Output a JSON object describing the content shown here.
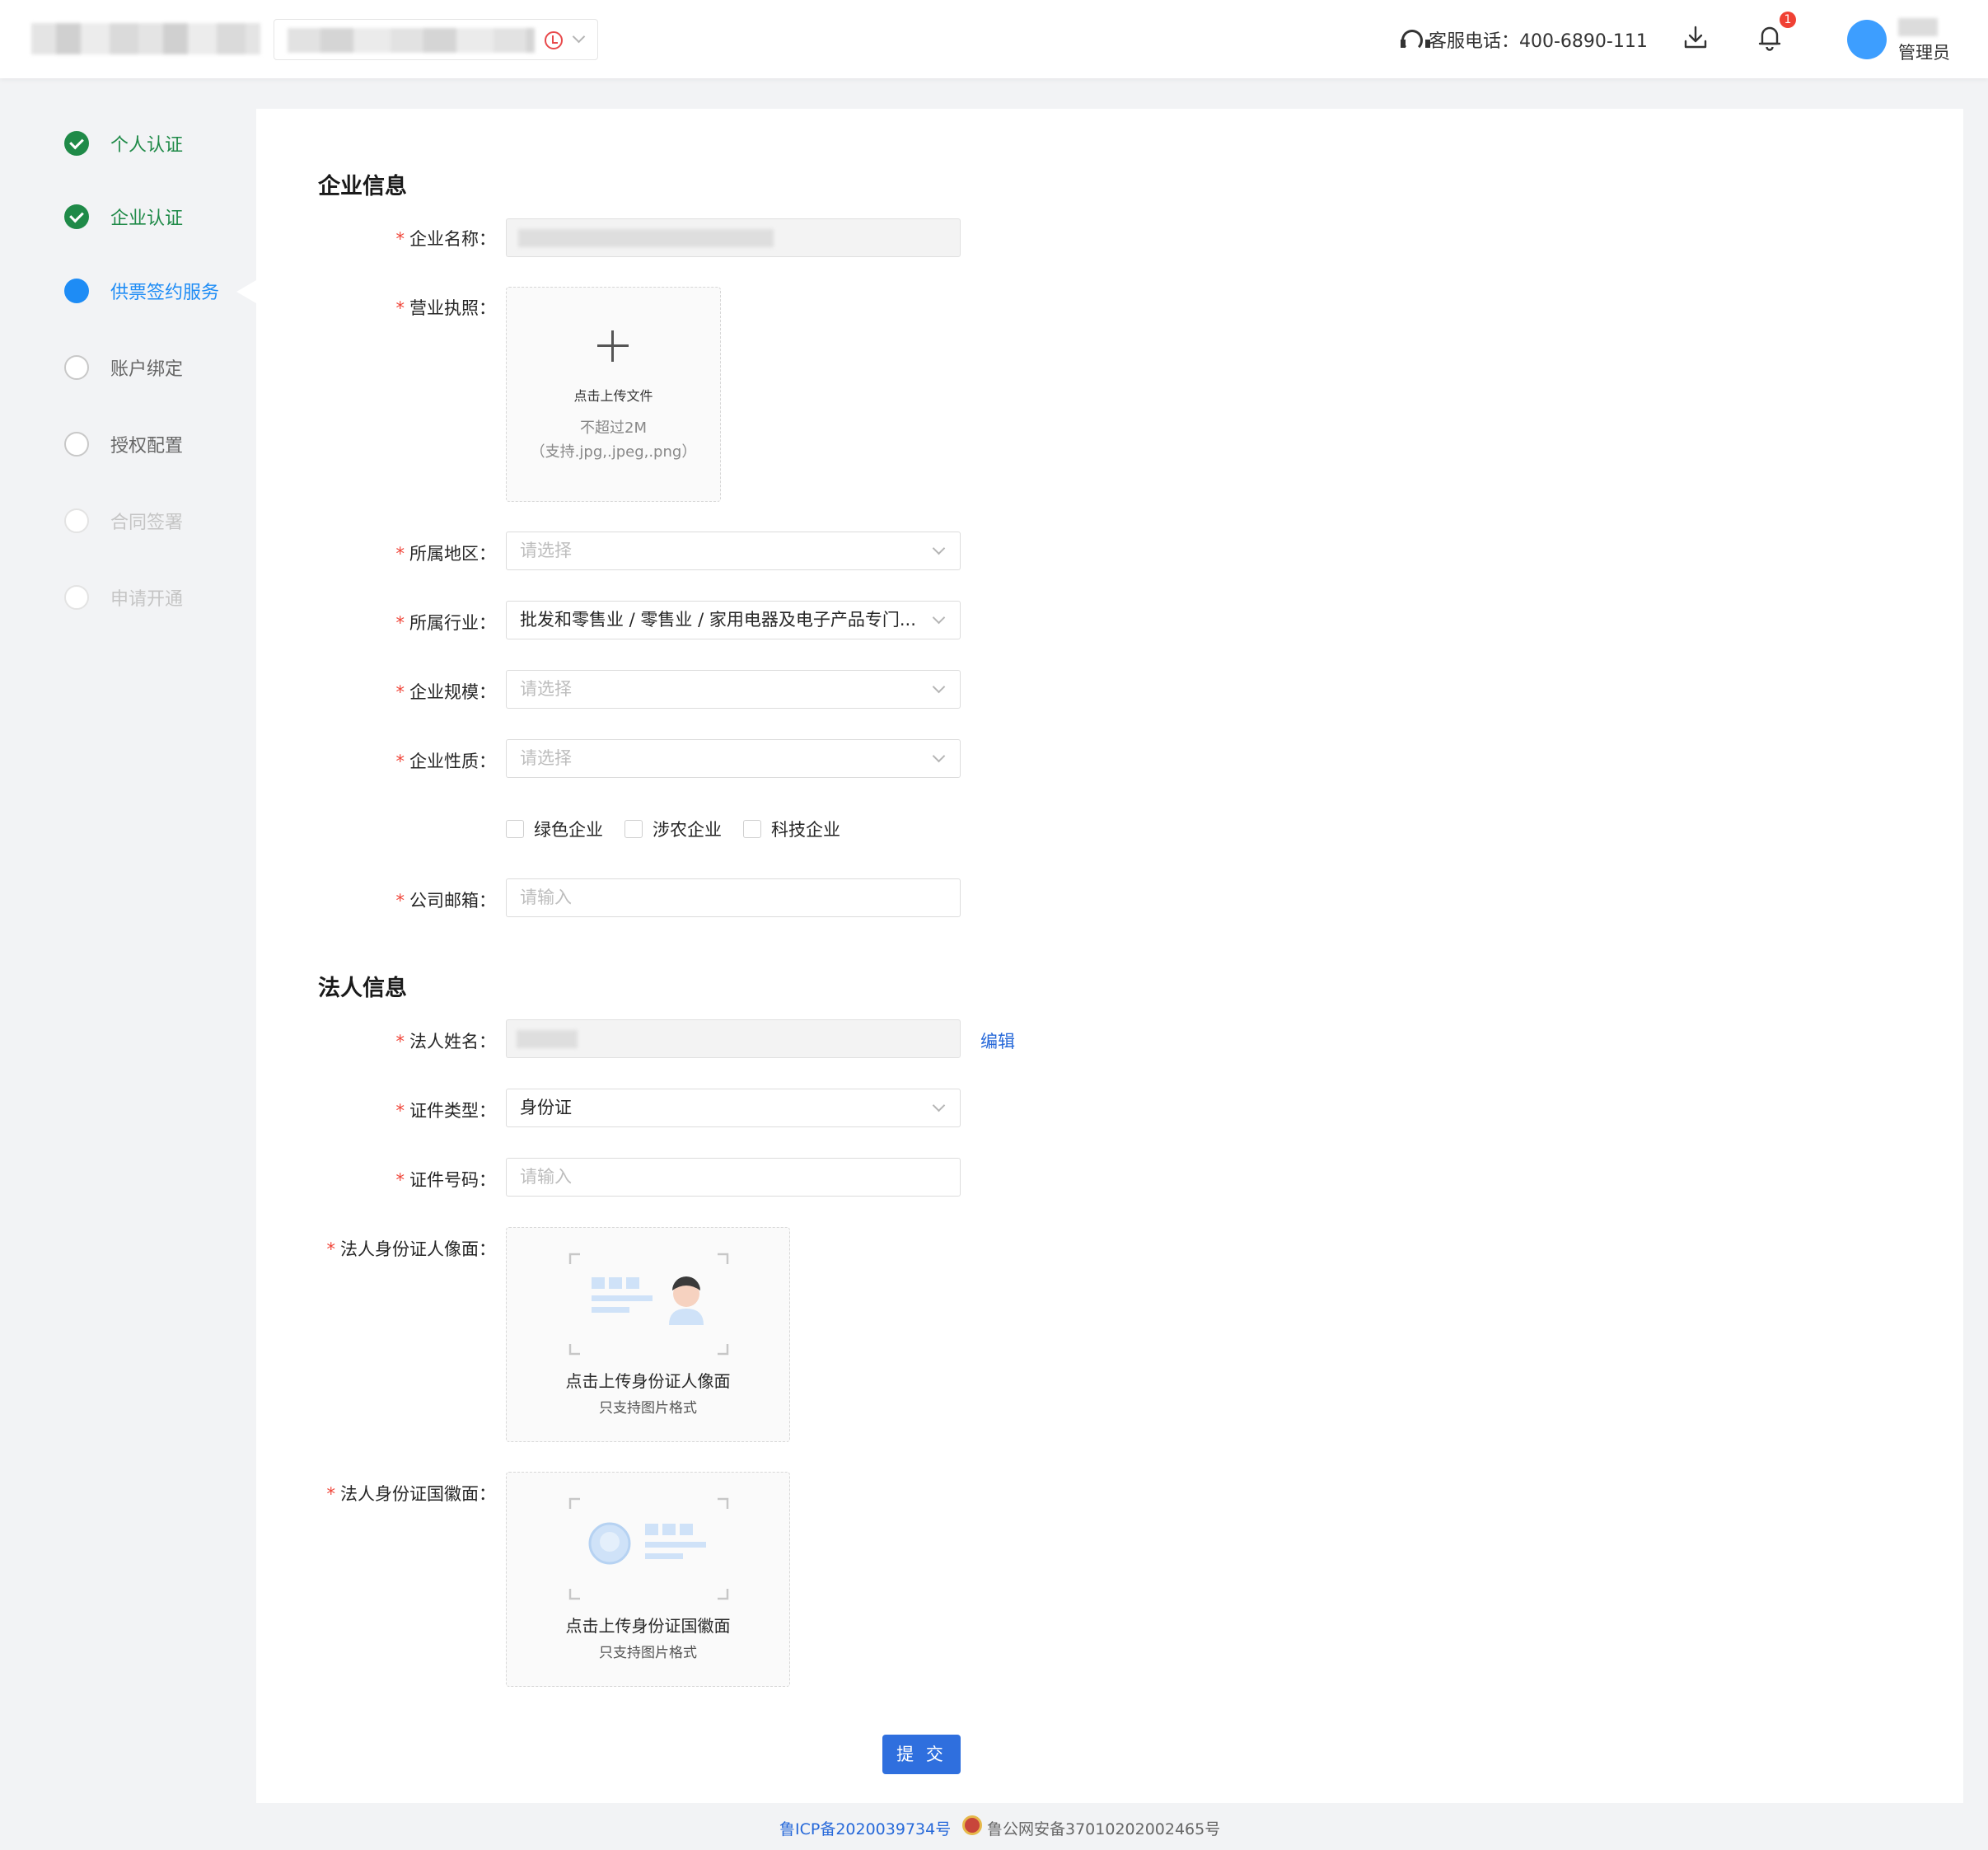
{
  "header": {
    "hotline_label": "客服电话：400-6890-111",
    "notification_count": "1",
    "role": "管理员",
    "icons": [
      "headset-icon",
      "download-icon",
      "bell-icon",
      "avatar"
    ]
  },
  "steps": [
    {
      "label": "个人认证",
      "state": "done"
    },
    {
      "label": "企业认证",
      "state": "done"
    },
    {
      "label": "供票签约服务",
      "state": "active"
    },
    {
      "label": "账户绑定",
      "state": "todo"
    },
    {
      "label": "授权配置",
      "state": "todo"
    },
    {
      "label": "合同签署",
      "state": "disabled"
    },
    {
      "label": "申请开通",
      "state": "disabled"
    }
  ],
  "company": {
    "section_title": "企业信息",
    "name_label": "企业名称：",
    "license_label": "营业执照：",
    "license_upload": {
      "title": "点击上传文件",
      "limit": "不超过2M",
      "formats": "（支持.jpg,.jpeg,.png）"
    },
    "region_label": "所属地区：",
    "region_placeholder": "请选择",
    "industry_label": "所属行业：",
    "industry_value": "批发和零售业 / 零售业 / 家用电器及电子产品专门...",
    "scale_label": "企业规模：",
    "scale_placeholder": "请选择",
    "nature_label": "企业性质：",
    "nature_placeholder": "请选择",
    "tags": [
      "绿色企业",
      "涉农企业",
      "科技企业"
    ],
    "email_label": "公司邮箱：",
    "email_placeholder": "请输入"
  },
  "legal": {
    "section_title": "法人信息",
    "name_label": "法人姓名：",
    "edit_label": "编辑",
    "id_type_label": "证件类型：",
    "id_type_value": "身份证",
    "id_number_label": "证件号码：",
    "id_number_placeholder": "请输入",
    "front_label": "法人身份证人像面：",
    "front_upload": {
      "title": "点击上传身份证人像面",
      "hint": "只支持图片格式"
    },
    "back_label": "法人身份证国徽面：",
    "back_upload": {
      "title": "点击上传身份证国徽面",
      "hint": "只支持图片格式"
    }
  },
  "submit_label": "提 交",
  "footer": {
    "icp": "鲁ICP备2020039734号",
    "gongan": "鲁公网安备37010202002465号"
  },
  "colors": {
    "primary": "#2f6fde",
    "step_done": "#1f8a48",
    "step_active": "#1e8cf5",
    "required": "#f0463a",
    "badge": "#f04134"
  }
}
